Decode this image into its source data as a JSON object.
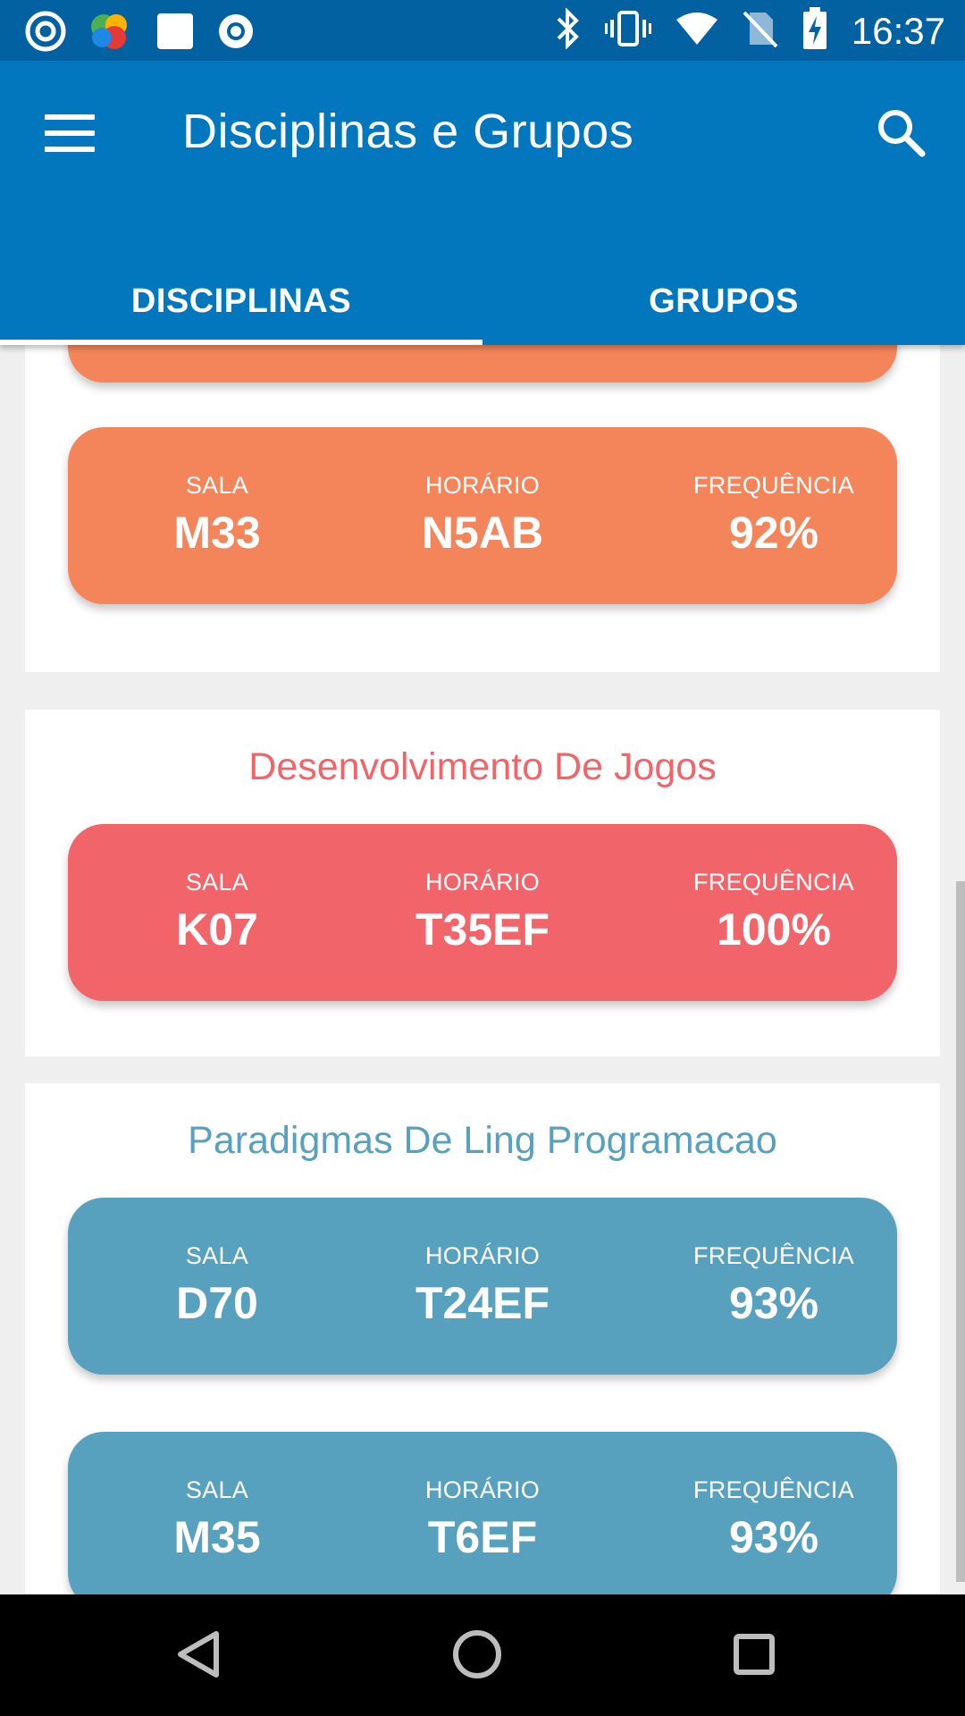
{
  "status_bar": {
    "time": "16:37",
    "left_icons": [
      "notification-target-icon",
      "colorful-app-icon",
      "white-square-icon",
      "record-icon"
    ],
    "right_icons": [
      "bluetooth-icon",
      "vibrate-icon",
      "wifi-icon",
      "no-sim-icon",
      "battery-charging-icon"
    ]
  },
  "app_bar": {
    "title": "Disciplinas e Grupos",
    "menu_icon": "hamburger-menu-icon",
    "search_icon": "search-icon",
    "color": "#0277bd"
  },
  "tabs": [
    {
      "label": "DISCIPLINAS",
      "selected": true
    },
    {
      "label": "GRUPOS",
      "selected": false
    }
  ],
  "courses": [
    {
      "title": "",
      "color": "#f4855b",
      "sessions": [
        {
          "room_label": "SALA",
          "room": "M33",
          "time_label": "HORÁRIO",
          "time": "N5AB",
          "freq_label": "FREQUÊNCIA",
          "freq": "92%"
        }
      ]
    },
    {
      "title": "Desenvolvimento De Jogos",
      "color": "#f1646a",
      "sessions": [
        {
          "room_label": "SALA",
          "room": "K07",
          "time_label": "HORÁRIO",
          "time": "T35EF",
          "freq_label": "FREQUÊNCIA",
          "freq": "100%"
        }
      ]
    },
    {
      "title": "Paradigmas De Ling Programacao",
      "color": "#58a1be",
      "sessions": [
        {
          "room_label": "SALA",
          "room": "D70",
          "time_label": "HORÁRIO",
          "time": "T24EF",
          "freq_label": "FREQUÊNCIA",
          "freq": "93%"
        },
        {
          "room_label": "SALA",
          "room": "M35",
          "time_label": "HORÁRIO",
          "time": "T6EF",
          "freq_label": "FREQUÊNCIA",
          "freq": "93%"
        }
      ]
    }
  ],
  "nav_bar": {
    "icons": [
      "back-triangle-icon",
      "home-circle-icon",
      "recents-square-icon"
    ]
  }
}
